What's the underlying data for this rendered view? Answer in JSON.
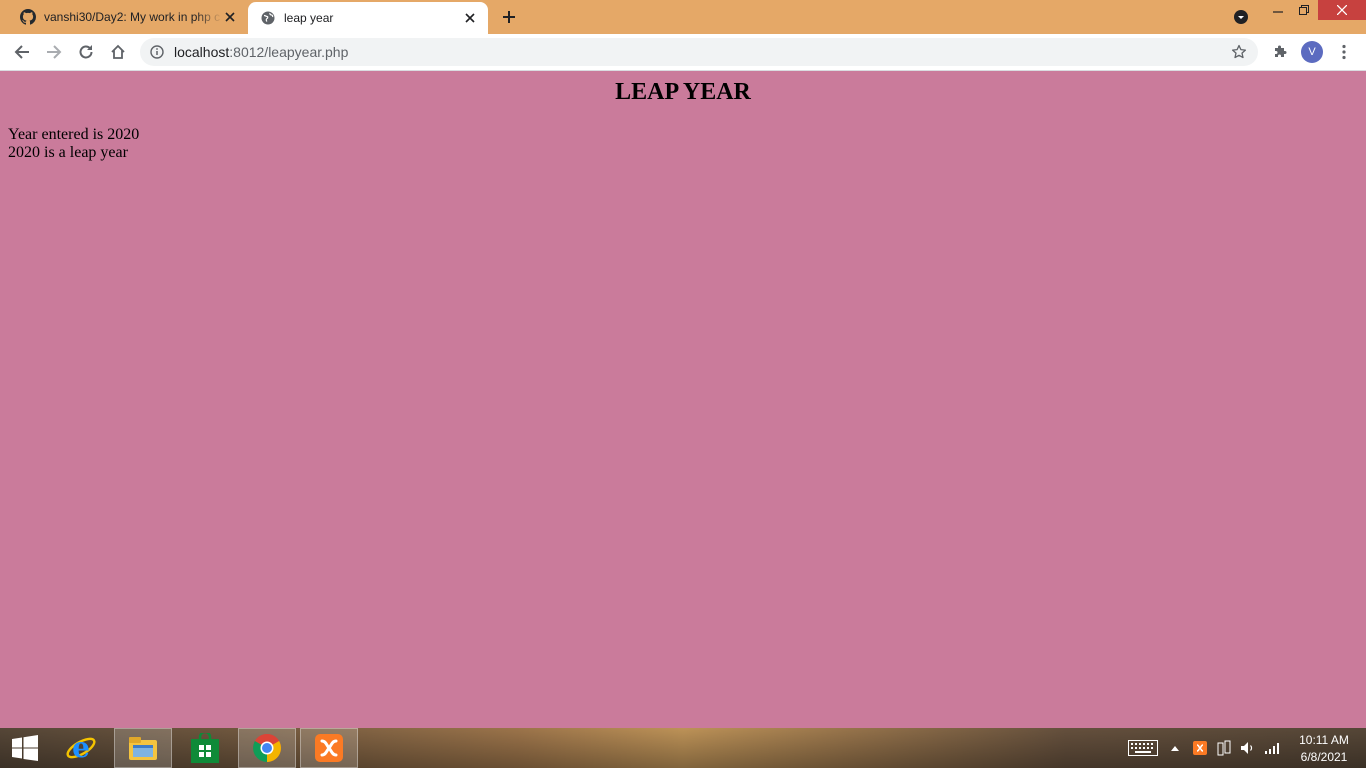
{
  "browser": {
    "tabs": [
      {
        "title": "vanshi30/Day2: My work in php c",
        "icon": "github-icon",
        "active": false
      },
      {
        "title": "leap year",
        "icon": "globe-icon",
        "active": true
      }
    ],
    "url_host": "localhost",
    "url_path": ":8012/leapyear.php",
    "profile_initial": "V",
    "colors": {
      "frame": "#e5a867",
      "close": "#c7413f",
      "profile": "#5c6bc0"
    }
  },
  "page": {
    "heading": "LEAP YEAR",
    "line1": "Year entered is 2020",
    "line2": "2020 is a leap year",
    "background": "#ca7b9b"
  },
  "taskbar": {
    "apps": [
      "windows-start-icon",
      "internet-explorer-icon",
      "file-explorer-icon",
      "store-icon",
      "chrome-icon",
      "xampp-icon"
    ],
    "time": "10:11 AM",
    "date": "6/8/2021"
  }
}
